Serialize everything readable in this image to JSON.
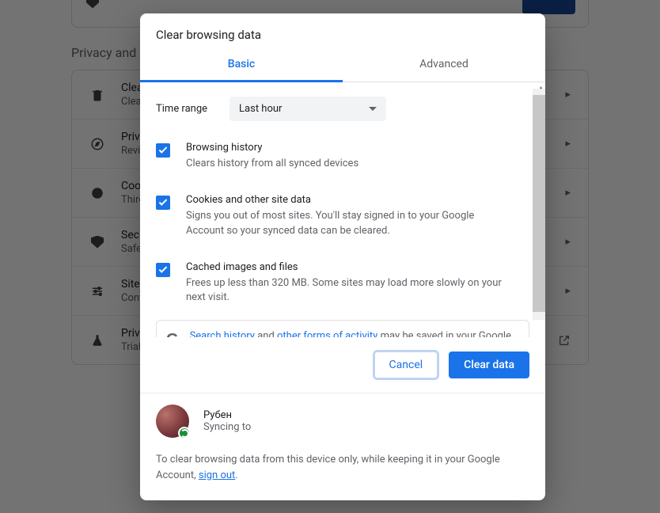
{
  "background": {
    "section_title": "Privacy and security",
    "rows": [
      {
        "title": "Clear browsing data",
        "sub": "Clear history, cookies, cache, and more"
      },
      {
        "title": "Privacy Guide",
        "sub": "Review key privacy and security controls"
      },
      {
        "title": "Cookies and other site data",
        "sub": "Third-party cookies are blocked in Incognito mode"
      },
      {
        "title": "Security",
        "sub": "Safe Browsing (protection from dangerous sites) and other security settings"
      },
      {
        "title": "Site settings",
        "sub": "Controls what information sites can use and show"
      },
      {
        "title": "Privacy Sandbox",
        "sub": "Trial features are on"
      }
    ]
  },
  "dialog": {
    "title": "Clear browsing data",
    "tabs": {
      "basic": "Basic",
      "advanced": "Advanced"
    },
    "timerange": {
      "label": "Time range",
      "value": "Last hour"
    },
    "items": [
      {
        "title": "Browsing history",
        "sub": "Clears history from all synced devices"
      },
      {
        "title": "Cookies and other site data",
        "sub": "Signs you out of most sites. You'll stay signed in to your Google Account so your synced data can be cleared."
      },
      {
        "title": "Cached images and files",
        "sub": "Frees up less than 320 MB. Some sites may load more slowly on your next visit."
      }
    ],
    "info": {
      "link1": "Search history",
      "mid1": " and ",
      "link2": "other forms of activity",
      "rest": " may be saved in your Google Account when you're signed in. You can delete them anytime."
    },
    "actions": {
      "cancel": "Cancel",
      "clear": "Clear data"
    },
    "profile": {
      "name": "Рубен",
      "sub": "Syncing to"
    },
    "footer": {
      "text_before": "To clear browsing data from this device only, while keeping it in your Google Account, ",
      "link": "sign out",
      "text_after": "."
    }
  }
}
